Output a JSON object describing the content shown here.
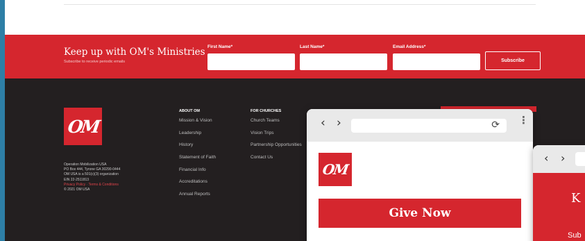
{
  "newsletter": {
    "title": "Keep up with OM's Ministries",
    "subtitle": "Subscribe to receive periodic emails",
    "fields": [
      {
        "label": "First Name*",
        "value": ""
      },
      {
        "label": "Last Name*",
        "value": ""
      },
      {
        "label": "Email Address*",
        "value": ""
      }
    ],
    "button": "Subscribe"
  },
  "footer": {
    "logo_text": "OM",
    "org_lines": [
      "Operation Mobilization USA",
      "PO Box 444, Tyrone GA 30290-0444",
      "OM USA is a 501(c)(3) organization",
      "EIN 22-2511813"
    ],
    "policy_links": "Privacy Policy · Terms & Conditions",
    "copyright": "© 2021 OM USA",
    "about": {
      "heading": "ABOUT OM",
      "links": [
        "Mission & Vision",
        "Leadership",
        "History",
        "Statement of Faith",
        "Financial Info",
        "Accreditations",
        "Annual Reports"
      ]
    },
    "churches": {
      "heading": "FOR CHURCHES",
      "links": [
        "Church Teams",
        "Vision Trips",
        "Partnership Opportunities",
        "Contact Us"
      ]
    }
  },
  "popup": {
    "back_glyph": "‹",
    "forward_glyph": "›",
    "reload_glyph": "⟳",
    "menu_glyph": "⋮",
    "logo_text": "OM",
    "give_button": "Give Now"
  },
  "popup2": {
    "back_glyph": "‹",
    "forward_glyph": "›",
    "heading_fragment": "K",
    "sub_fragment": "Sub"
  },
  "colors": {
    "brand_red": "#d5262e",
    "footer_dark": "#231f20",
    "desktop_blue": "#2e7fa6"
  },
  "icons": [
    "back-arrow-icon",
    "forward-arrow-icon",
    "reload-icon",
    "more-menu-icon",
    "om-logo"
  ]
}
